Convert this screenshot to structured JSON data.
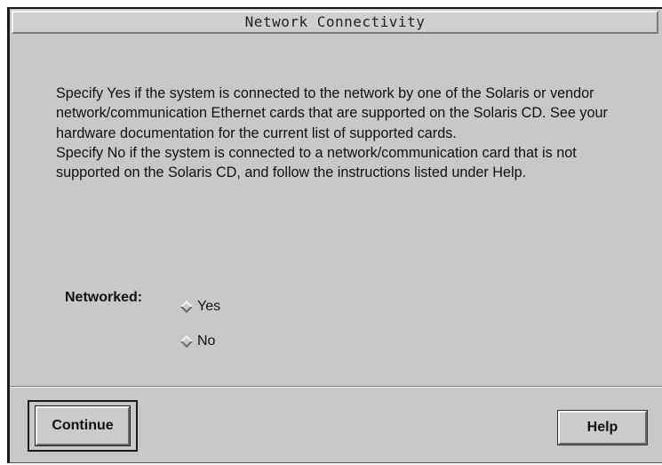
{
  "window": {
    "title": "Network Connectivity"
  },
  "content": {
    "paragraph1": "Specify Yes if the system is connected to the network by one of the Solaris or vendor network/communication Ethernet cards that are supported on the Solaris CD.  See your hardware documentation for the current list of supported cards.",
    "paragraph2": "Specify No if the system is connected to a network/communication card that is not supported on the Solaris CD, and follow the instructions listed under Help."
  },
  "networked": {
    "label": "Networked:",
    "options": [
      {
        "label": "Yes",
        "selected": false
      },
      {
        "label": "No",
        "selected": false
      }
    ]
  },
  "buttons": {
    "continue_label": "Continue",
    "help_label": "Help"
  },
  "icons": {
    "radio": "diamond-radio-icon"
  },
  "colors": {
    "background": "#c8c8c8",
    "text": "#111111"
  }
}
